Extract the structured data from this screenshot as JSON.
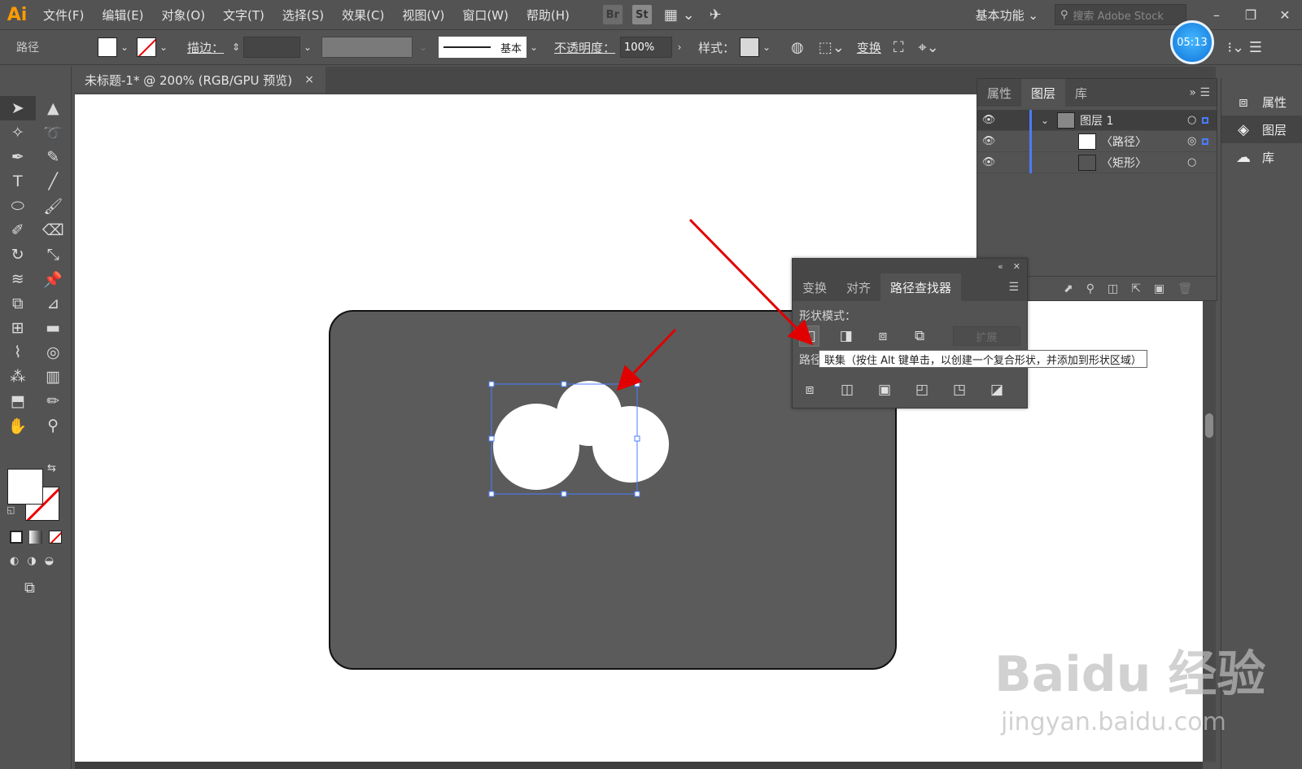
{
  "app": {
    "logo": "Ai",
    "menu": [
      "文件(F)",
      "编辑(E)",
      "对象(O)",
      "文字(T)",
      "选择(S)",
      "效果(C)",
      "视图(V)",
      "窗口(W)",
      "帮助(H)"
    ],
    "bridge_label": "Br",
    "stock_label": "St",
    "workspace": "基本功能",
    "search_placeholder": "搜索 Adobe Stock"
  },
  "control_bar": {
    "selection_label": "路径",
    "stroke_label": "描边：",
    "stroke_style": "基本",
    "opacity_label": "不透明度：",
    "opacity_value": "100%",
    "style_label": "样式：",
    "transform_label": "变换"
  },
  "timer": "05:13",
  "document": {
    "tab_title": "未标题-1* @ 200% (RGB/GPU 预览)",
    "close_glyph": "×"
  },
  "layers_panel": {
    "tabs": [
      "属性",
      "图层",
      "库"
    ],
    "active_tab": "图层",
    "rows": [
      {
        "name": "图层 1"
      },
      {
        "name": "〈路径〉"
      },
      {
        "name": "〈矩形〉"
      }
    ]
  },
  "right_dock": {
    "items": [
      "属性",
      "图层",
      "库"
    ]
  },
  "pathfinder_panel": {
    "tabs": [
      "变换",
      "对齐",
      "路径查找器"
    ],
    "active_tab": "路径查找器",
    "shape_modes_label": "形状模式：",
    "pathfinders_label": "路径查找器：",
    "expand_label": "扩展"
  },
  "tooltip": "联集（按住 Alt 键单击，以创建一个复合形状，并添加到形状区域）",
  "watermark": {
    "brand": "Baidu 经验",
    "url": "jingyan.baidu.com"
  },
  "colors": {
    "selection_blue": "#4a7cff",
    "annotation_red": "#e00000",
    "accent_orange": "#ff9a00"
  }
}
